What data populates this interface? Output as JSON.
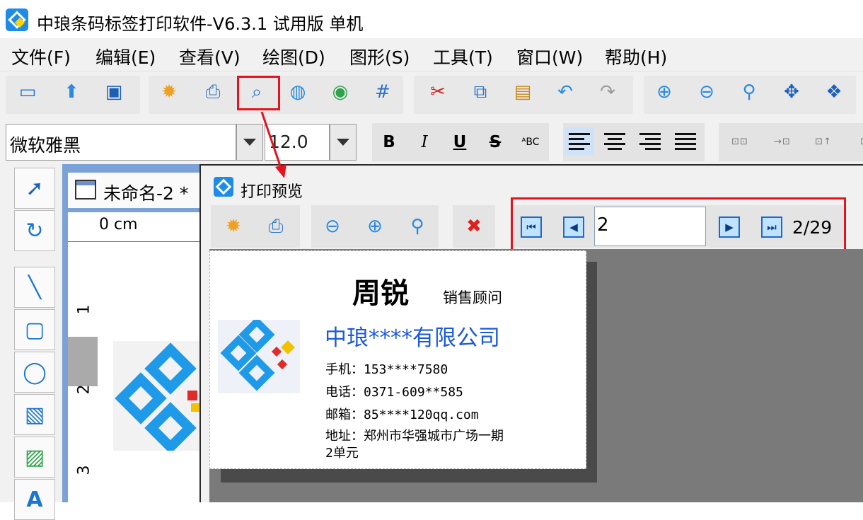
{
  "window": {
    "title": "中琅条码标签打印软件-V6.3.1 试用版 单机"
  },
  "menu": [
    "文件(F)",
    "编辑(E)",
    "查看(V)",
    "绘图(D)",
    "图形(S)",
    "工具(T)",
    "窗口(W)",
    "帮助(H)"
  ],
  "font": {
    "name": "微软雅黑",
    "size": "12.0"
  },
  "format": {
    "bold": "B",
    "italic": "I",
    "underline": "U",
    "strike": "S",
    "case": "ᴬBC"
  },
  "document": {
    "tab_label": "未命名-2 *",
    "ruler_label": "0 cm",
    "ruler_marks": [
      "1",
      "2",
      "3"
    ]
  },
  "preview": {
    "title": "打印预览",
    "page_value": "2",
    "page_counter": "2/29"
  },
  "card": {
    "name": "周锐",
    "role": "销售顾问",
    "company": "中琅****有限公司",
    "phone": "手机：153****7580",
    "tel": "电话：0371-609**585",
    "email": "邮箱：85****120qq.com",
    "address_1": "地址：郑州市华强城市广场一期",
    "address_2": "2单元"
  },
  "colors": {
    "highlight": "#e3141f",
    "brand_blue": "#1b5ad8",
    "logo_blue": "#1e8ce6"
  }
}
